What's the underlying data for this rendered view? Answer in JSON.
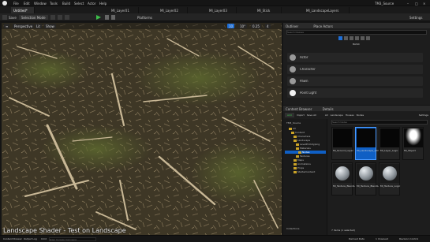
{
  "menubar": {
    "items": [
      "File",
      "Edit",
      "Window",
      "Tools",
      "Build",
      "Select",
      "Actor",
      "Help"
    ],
    "project": "TM3_Source",
    "window_controls": [
      "–",
      "□",
      "×"
    ]
  },
  "tabs": [
    "Untitled*",
    "MI_Layer01",
    "MI_Layer02",
    "MI_Layer03",
    "MI_Stick",
    "MI_LandscapeLayers"
  ],
  "toolbar": {
    "save_label": "Save",
    "mode_label": "Selection Mode",
    "platforms_label": "Platforms",
    "settings_label": "Settings"
  },
  "viewport": {
    "perspective_label": "Perspective",
    "lit_label": "Lit",
    "show_label": "Show",
    "right_chips": [
      "10",
      "10°",
      "0.25",
      "4"
    ]
  },
  "outliner": {
    "tab_outliner": "Outliner",
    "tab_place": "Place Actors",
    "search_placeholder": "Search Classes",
    "section_label": "BASIC",
    "items": [
      "Actor",
      "Character",
      "Pawn",
      "Point Light"
    ]
  },
  "content_browser": {
    "tab": "Content Browser",
    "details_tab": "Details",
    "add_label": "Add",
    "import_label": "Import",
    "save_all_label": "Save All",
    "breadcrumb": [
      "All",
      "Landscape",
      "Houses",
      "Nodes"
    ],
    "settings_label": "Settings",
    "root_label": "TM3_Source",
    "search_placeholder": "Search Nodes",
    "tree": [
      "All",
      "Content",
      "Characters",
      "Landscape",
      "LevelPrototyping",
      "Materials",
      "Nodes",
      "Textures",
      "Maps",
      "Animations",
      "Props",
      "StarterContent"
    ],
    "assets": [
      {
        "label": "MI_Ground_Layer",
        "kind": "dark"
      },
      {
        "label": "MI_Landscape_LAYER",
        "kind": "selected"
      },
      {
        "label": "MI_Layer_Logic",
        "kind": "dark"
      },
      {
        "label": "MI_Object",
        "kind": "glow"
      },
      {
        "label": "MI_Texture_BlendLogic",
        "kind": "sphere"
      },
      {
        "label": "MI_Texture_BlendLogic_Blended",
        "kind": "sphere"
      },
      {
        "label": "MI_Texture_Logic",
        "kind": "sphere"
      }
    ],
    "footer": "7 items (1 selected)",
    "collections": "Collections"
  },
  "statusbar": {
    "content_drawer": "Content Drawer",
    "output_log": "Output Log",
    "cmd": "Cmd",
    "console_placeholder": "Enter Console Command",
    "derived_data": "Derived Data",
    "unsaved": "1 Unsaved",
    "revision": "Revision Control"
  },
  "subtitle": "Landscape Shader - Test on Landscape",
  "colors": {
    "accent": "#1e6fd8",
    "folder": "#c9a227",
    "selected": "#0f5fc4",
    "play": "#3cbf4a"
  }
}
